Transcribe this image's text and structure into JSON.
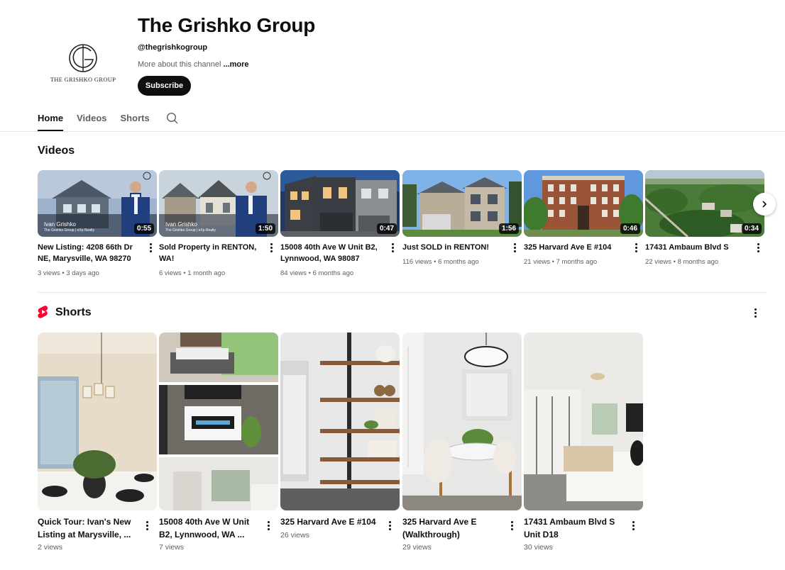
{
  "channel": {
    "title": "The Grishko Group",
    "handle": "@thegrishkogroup",
    "about_text": "More about this channel ",
    "about_more": "...more",
    "subscribe_label": "Subscribe",
    "avatar_text": "THE GRISHKO GROUP"
  },
  "tabs": [
    {
      "label": "Home",
      "active": true
    },
    {
      "label": "Videos",
      "active": false
    },
    {
      "label": "Shorts",
      "active": false
    }
  ],
  "sections": {
    "videos_title": "Videos",
    "shorts_title": "Shorts"
  },
  "videos": [
    {
      "title": "New Listing: 4208 66th Dr NE, Marysville, WA 98270",
      "duration": "0:55",
      "meta": "3 views • 3 days ago"
    },
    {
      "title": "Sold Property in RENTON, WA!",
      "duration": "1:50",
      "meta": "6 views • 1 month ago"
    },
    {
      "title": "15008 40th Ave W Unit B2, Lynnwood, WA 98087",
      "duration": "0:47",
      "meta": "84 views • 6 months ago"
    },
    {
      "title": "Just SOLD in RENTON!",
      "duration": "1:56",
      "meta": "116 views • 6 months ago"
    },
    {
      "title": "325 Harvard Ave E #104",
      "duration": "0:46",
      "meta": "21 views • 7 months ago"
    },
    {
      "title": "17431 Ambaum Blvd S",
      "duration": "0:34",
      "meta": "22 views • 8 months ago"
    }
  ],
  "thumb_overlay": {
    "agent_name": "Ivan Grishko",
    "agent_sub": "The Grishko Group | eXp Realty"
  },
  "shorts": [
    {
      "title": "Quick Tour: Ivan's New Listing at Marysville, ...",
      "meta": "2 views"
    },
    {
      "title": "15008 40th Ave W Unit B2, Lynnwood, WA ...",
      "meta": "7 views"
    },
    {
      "title": "325 Harvard Ave E #104",
      "meta": "26 views"
    },
    {
      "title": "325 Harvard Ave E (Walkthrough)",
      "meta": "29 views"
    },
    {
      "title": "17431 Ambaum Blvd S Unit D18",
      "meta": "30 views"
    }
  ],
  "icons": {
    "search": "search-icon",
    "next": "chevron-right-icon",
    "more": "more-vert-icon",
    "shorts": "shorts-logo-icon"
  },
  "colors": {
    "text": "#0f0f0f",
    "secondary": "#606060",
    "shorts_red": "#ff0033"
  }
}
